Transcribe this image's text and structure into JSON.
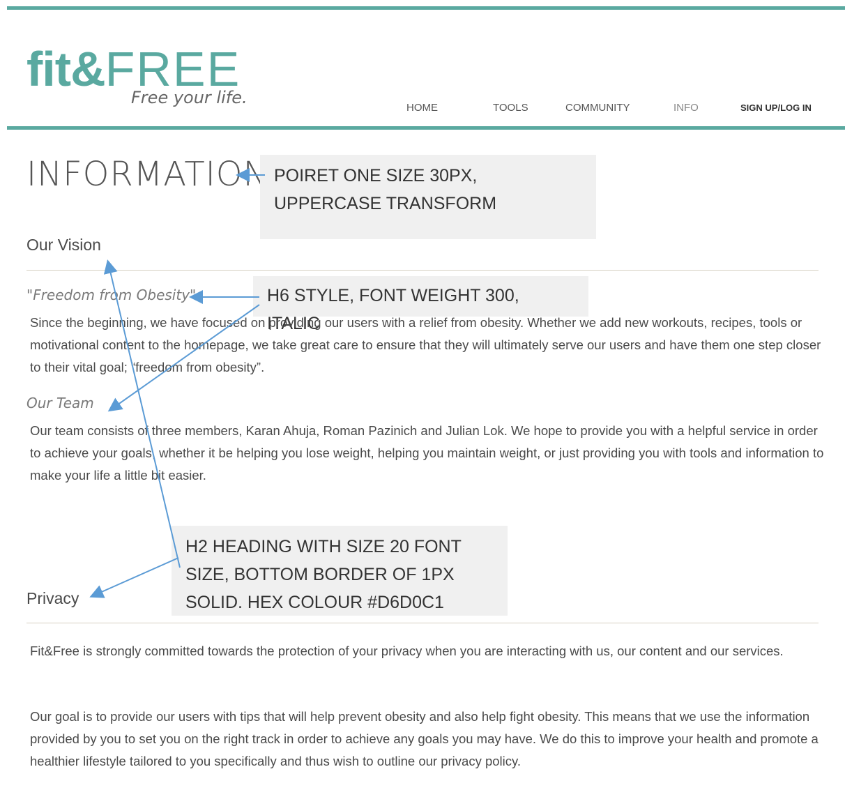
{
  "header": {
    "logo": {
      "main_bold": "fit&",
      "main_light": "FREE",
      "tagline": "Free your life."
    },
    "nav": [
      {
        "label": "HOME"
      },
      {
        "label": "TOOLS"
      },
      {
        "label": "COMMUNITY"
      },
      {
        "label": "INFO"
      },
      {
        "label": "SIGN UP/LOG IN"
      }
    ]
  },
  "page": {
    "title": "INFORMATION",
    "vision": {
      "heading": "Our Vision",
      "quote": "\"Freedom from Obesity\"",
      "body": "Since the beginning, we have focused on providing our users with a relief from obesity. Whether we add new workouts, recipes, tools or motivational content to the homepage, we take great care to ensure that they will ultimately serve our users and have them one step closer to their vital goal; “freedom from obesity”."
    },
    "team": {
      "heading": "Our Team",
      "body": "Our team consists of three members, Karan Ahuja, Roman Pazinich and Julian Lok. We hope to provide you with a helpful service in order to achieve your goals, whether it be helping you lose weight, helping you maintain weight, or just providing you with tools and information to make your life a little bit easier."
    },
    "privacy": {
      "heading": "Privacy",
      "para1": "Fit&Free is strongly committed towards the protection of your privacy when you are interacting with us, our content and our services.",
      "para2": "Our goal is to provide our users with tips that will help prevent obesity and also help fight obesity. This means that we use the information provided by you to set you on the right track in order to achieve any goals you may have. We do this to improve your health and promote a healthier lifestyle tailored to you specifically and thus wish to outline our privacy policy."
    }
  },
  "annotations": {
    "title_note": "Poiret One size 30px, uppercase transform",
    "h6_note": "H6 style, font weight 300, italic",
    "h2_note": "H2 heading with size 20 font size, bottom border of 1px solid. Hex colour #D6D0C1"
  },
  "colors": {
    "accent": "#5aa9a0",
    "divider": "#d6d0c1",
    "annotation_bg": "#f0f0f0",
    "arrow": "#5b9bd5"
  }
}
